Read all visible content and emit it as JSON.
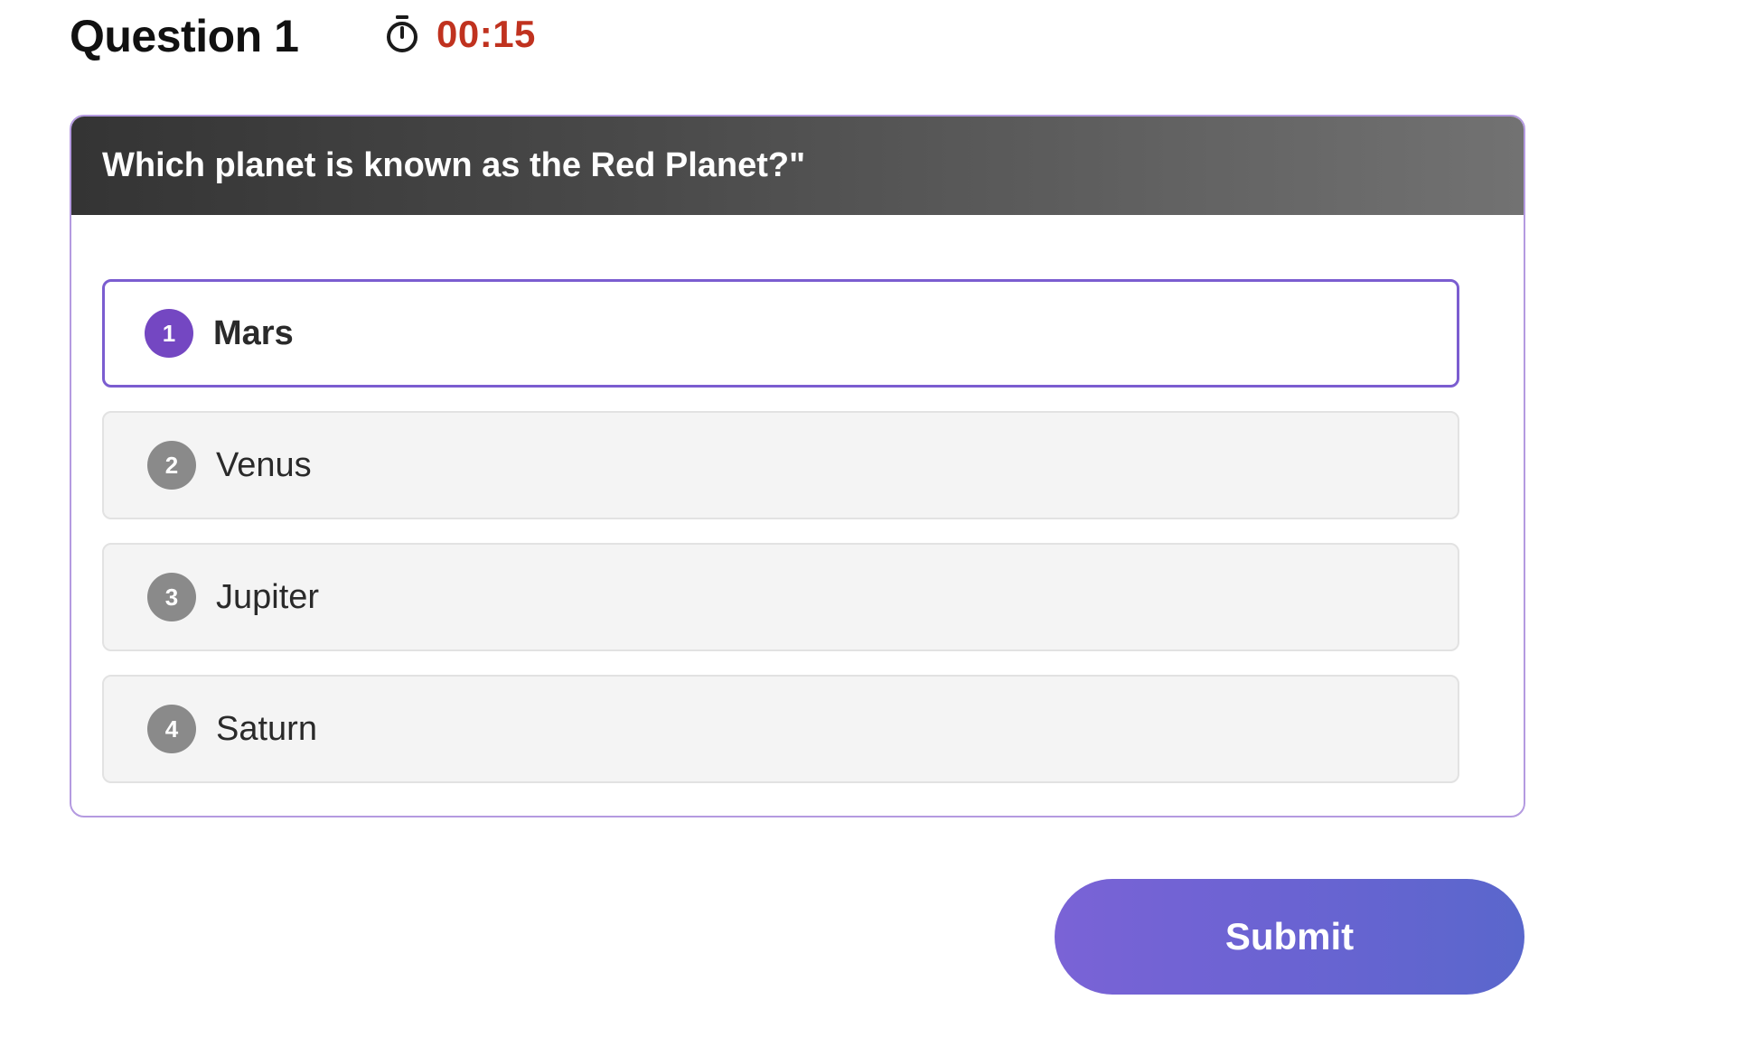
{
  "header": {
    "title": "Question 1",
    "timer_icon": "stopwatch-icon",
    "timer": "00:15",
    "timer_color": "#c0321f"
  },
  "question": {
    "text": "Which planet is known as the Red Planet?\""
  },
  "options": [
    {
      "number": "1",
      "label": "Mars",
      "selected": true
    },
    {
      "number": "2",
      "label": "Venus",
      "selected": false
    },
    {
      "number": "3",
      "label": "Jupiter",
      "selected": false
    },
    {
      "number": "4",
      "label": "Saturn",
      "selected": false
    }
  ],
  "submit": {
    "label": "Submit"
  },
  "colors": {
    "accent": "#7b5dd0",
    "selected_badge": "#7447c2",
    "unselected_badge": "#8a8a8a"
  }
}
